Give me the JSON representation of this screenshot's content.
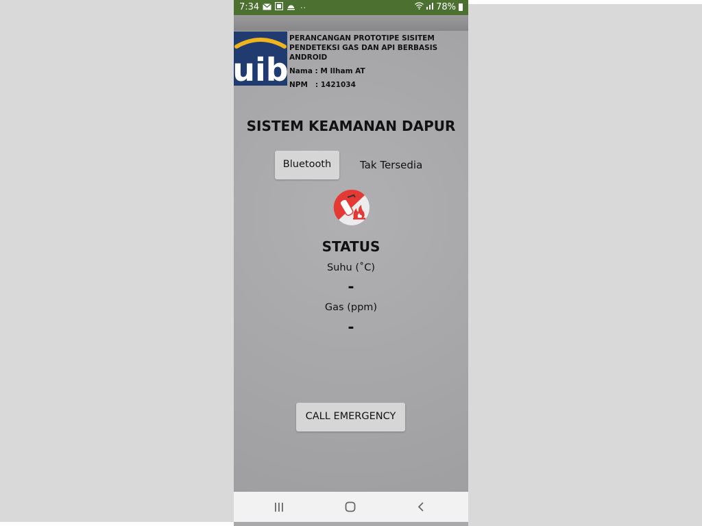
{
  "status_bar": {
    "time": "7:34",
    "dots": "··",
    "battery": "78%",
    "icons": [
      "mail-icon",
      "gallery-icon",
      "weather-icon",
      "wifi-icon",
      "signal-icon",
      "battery-icon"
    ]
  },
  "header": {
    "logo_text": "uib",
    "title_line1": "PERANCANGAN PROTOTIPE SISITEM",
    "title_line2": "PENDETEKSI GAS DAN API BERBASIS ANDROID",
    "nama": "Nama : M Ilham AT",
    "npm": "NPM   : 1421034"
  },
  "main": {
    "title": "SISTEM KEAMANAN DAPUR",
    "bluetooth_button": "Bluetooth",
    "bluetooth_status": "Tak Tersedia",
    "status_title": "STATUS",
    "suhu_label": "Suhu (˚C)",
    "suhu_value": "-",
    "gas_label": "Gas (ppm)",
    "gas_value": "-",
    "call_button": "CALL EMERGENCY"
  },
  "colors": {
    "status_bar": "#4c7030",
    "background": "#a9a9ab",
    "button": "#d6d6d6",
    "logo_bg": "#1f3b70",
    "logo_arc": "#f0b41c",
    "icon_red": "#e53935"
  }
}
